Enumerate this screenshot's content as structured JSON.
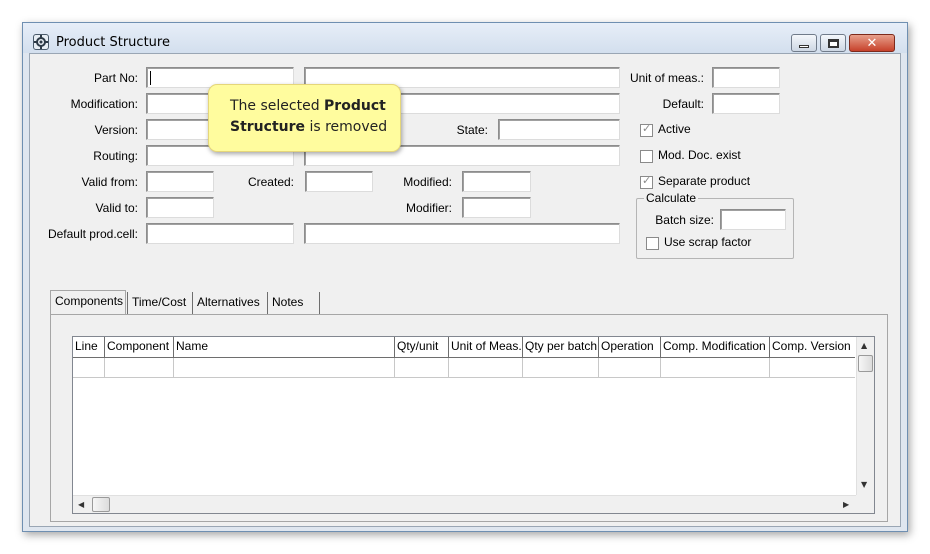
{
  "window": {
    "title": "Product Structure",
    "close_glyph": "✕"
  },
  "form": {
    "part_no_label": "Part No:",
    "modification_label": "Modification:",
    "version_label": "Version:",
    "routing_label": "Routing:",
    "valid_from_label": "Valid from:",
    "valid_to_label": "Valid to:",
    "default_prod_cell_label": "Default prod.cell:",
    "created_label": "Created:",
    "modified_label": "Modified:",
    "modifier_label": "Modifier:",
    "state_label": "State:",
    "unit_of_meas_label": "Unit of meas.:",
    "default_label": "Default:",
    "active_label": "Active",
    "mod_doc_exist_label": "Mod. Doc. exist",
    "separate_product_label": "Separate product",
    "calculate_group_label": "Calculate",
    "batch_size_label": "Batch size:",
    "use_scrap_factor_label": "Use scrap factor",
    "checkmark": "✓"
  },
  "tabs": [
    {
      "label": "Components"
    },
    {
      "label": "Time/Cost"
    },
    {
      "label": "Alternatives"
    },
    {
      "label": "Notes"
    }
  ],
  "grid": {
    "columns": [
      "Line",
      "Component",
      "Name",
      "Qty/unit",
      "Unit of Meas.",
      "Qty per batch",
      "Operation",
      "Comp. Modification",
      "Comp. Version"
    ]
  },
  "callout": {
    "part1": "The selected ",
    "bold1": "Product",
    "bold2": "Structure",
    "part2": " is removed"
  },
  "scroll": {
    "up": "▲",
    "down": "▼",
    "left": "◀",
    "right": "▶"
  }
}
